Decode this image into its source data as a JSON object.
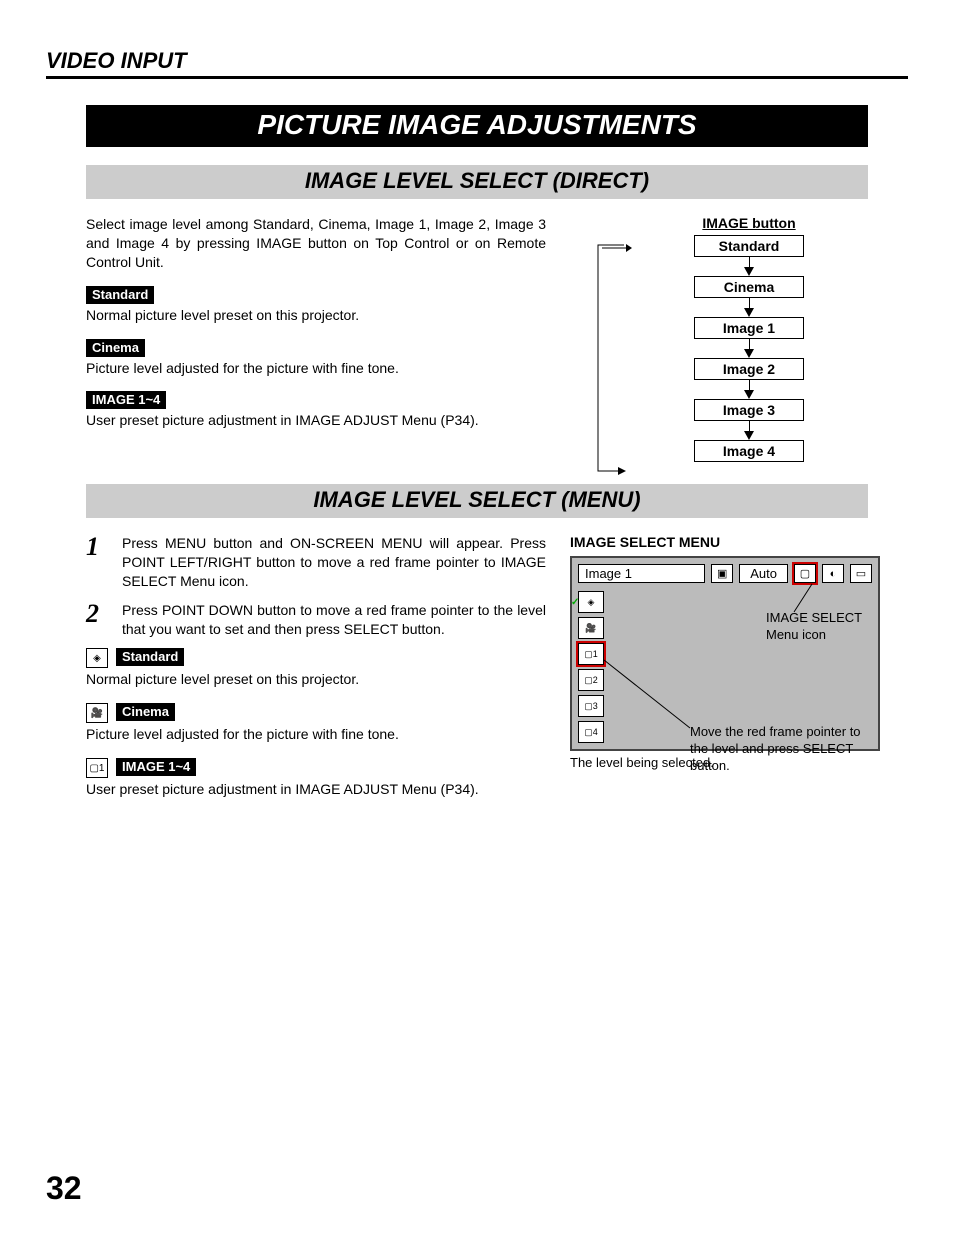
{
  "header": {
    "section": "VIDEO INPUT"
  },
  "title_bar": "PICTURE IMAGE ADJUSTMENTS",
  "direct": {
    "heading": "IMAGE LEVEL SELECT (DIRECT)",
    "intro": "Select image level among Standard, Cinema, Image 1, Image 2, Image 3 and Image 4 by pressing IMAGE button on Top Control or on Remote Control Unit.",
    "defs": [
      {
        "label": "Standard",
        "text": "Normal picture level preset on this projector."
      },
      {
        "label": "Cinema",
        "text": "Picture level adjusted for the picture with fine tone."
      },
      {
        "label": "IMAGE 1~4",
        "text": "User preset picture adjustment in IMAGE ADJUST Menu (P34)."
      }
    ],
    "chain": {
      "title": "IMAGE button",
      "items": [
        "Standard",
        "Cinema",
        "Image 1",
        "Image 2",
        "Image 3",
        "Image 4"
      ]
    }
  },
  "menu": {
    "heading": "IMAGE LEVEL SELECT (MENU)",
    "steps": [
      "Press MENU button and ON-SCREEN MENU will appear.  Press POINT LEFT/RIGHT button to move a red frame pointer to IMAGE SELECT Menu icon.",
      "Press POINT DOWN button to move a red frame pointer to the level that you want to set and then press SELECT button."
    ],
    "defs": [
      {
        "label": "Standard",
        "text": "Normal picture level preset on this projector."
      },
      {
        "label": "Cinema",
        "text": "Picture level adjusted for the picture with fine tone."
      },
      {
        "label": "IMAGE 1~4",
        "text": "User preset picture adjustment in IMAGE ADJUST Menu (P34)."
      }
    ],
    "osd": {
      "title": "IMAGE SELECT MENU",
      "current": "Image 1",
      "mode": "Auto",
      "side_items": [
        "◈",
        "🎥",
        "▢1",
        "▢2",
        "▢3",
        "▢4"
      ],
      "ann_icon": "IMAGE SELECT Menu icon",
      "ann_pointer": "Move the red frame pointer to the level and press SELECT button.",
      "caption": "The level being selected."
    }
  },
  "page_number": "32"
}
